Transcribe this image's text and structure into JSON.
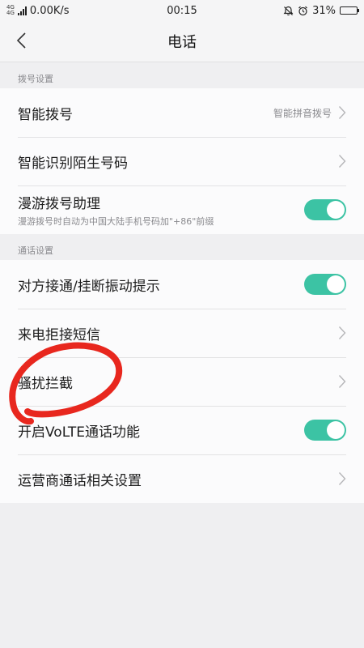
{
  "status_bar": {
    "network_type": "4G",
    "network_type_2": "4G",
    "speed": "0.00K/s",
    "time": "00:15",
    "battery": "31%",
    "battery_level": 0.31
  },
  "header": {
    "title": "电话",
    "back_icon": "chevron-left-icon"
  },
  "sections": [
    {
      "title": "拨号设置",
      "items": [
        {
          "label": "智能拨号",
          "value": "智能拼音拨号",
          "control": "chevron"
        },
        {
          "label": "智能识别陌生号码",
          "control": "chevron"
        },
        {
          "label": "漫游拨号助理",
          "subtitle": "漫游拨号时自动为中国大陆手机号码加\"+86\"前缀",
          "control": "toggle",
          "on": true
        }
      ]
    },
    {
      "title": "通话设置",
      "items": [
        {
          "label": "对方接通/挂断振动提示",
          "control": "toggle",
          "on": true
        },
        {
          "label": "来电拒接短信",
          "control": "chevron"
        },
        {
          "label": "骚扰拦截",
          "control": "chevron"
        },
        {
          "label": "开启VoLTE通话功能",
          "control": "toggle",
          "on": true
        },
        {
          "label": "运营商通话相关设置",
          "control": "chevron"
        }
      ]
    }
  ],
  "colors": {
    "toggle_on": "#3cc3a4",
    "annotation": "#e8271e"
  }
}
